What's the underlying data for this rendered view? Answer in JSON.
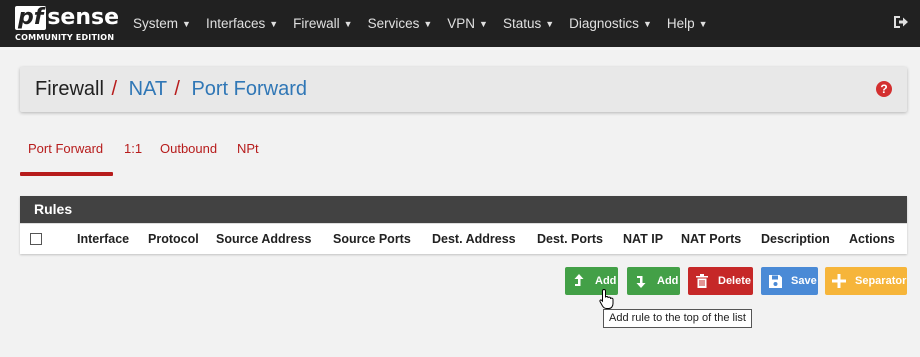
{
  "brand": {
    "logo_pf": "pf",
    "logo_sense": "sense",
    "edition": "COMMUNITY EDITION"
  },
  "nav": {
    "items": [
      {
        "label": "System"
      },
      {
        "label": "Interfaces"
      },
      {
        "label": "Firewall"
      },
      {
        "label": "Services"
      },
      {
        "label": "VPN"
      },
      {
        "label": "Status"
      },
      {
        "label": "Diagnostics"
      },
      {
        "label": "Help"
      }
    ],
    "logout_icon": "sign-out-icon"
  },
  "breadcrumb": {
    "root": "Firewall",
    "sep": "/",
    "items": [
      "NAT",
      "Port Forward"
    ],
    "help_glyph": "?"
  },
  "tabs": [
    {
      "label": "Port Forward",
      "active": true
    },
    {
      "label": "1:1"
    },
    {
      "label": "Outbound"
    },
    {
      "label": "NPt"
    }
  ],
  "rules": {
    "title": "Rules",
    "columns": [
      "Interface",
      "Protocol",
      "Source Address",
      "Source Ports",
      "Dest. Address",
      "Dest. Ports",
      "NAT IP",
      "NAT Ports",
      "Description",
      "Actions"
    ]
  },
  "buttons": {
    "add_top": "Add",
    "add_bottom": "Add",
    "delete": "Delete",
    "save": "Save",
    "separator": "Separator"
  },
  "tooltip": "Add rule to the top of the list",
  "colors": {
    "navbar": "#212121",
    "accent_red": "#b71c1c",
    "link_blue": "#3077b6",
    "success": "#43a047",
    "danger": "#c62828",
    "primary": "#4a8ad6",
    "warning": "#f6b53a"
  }
}
